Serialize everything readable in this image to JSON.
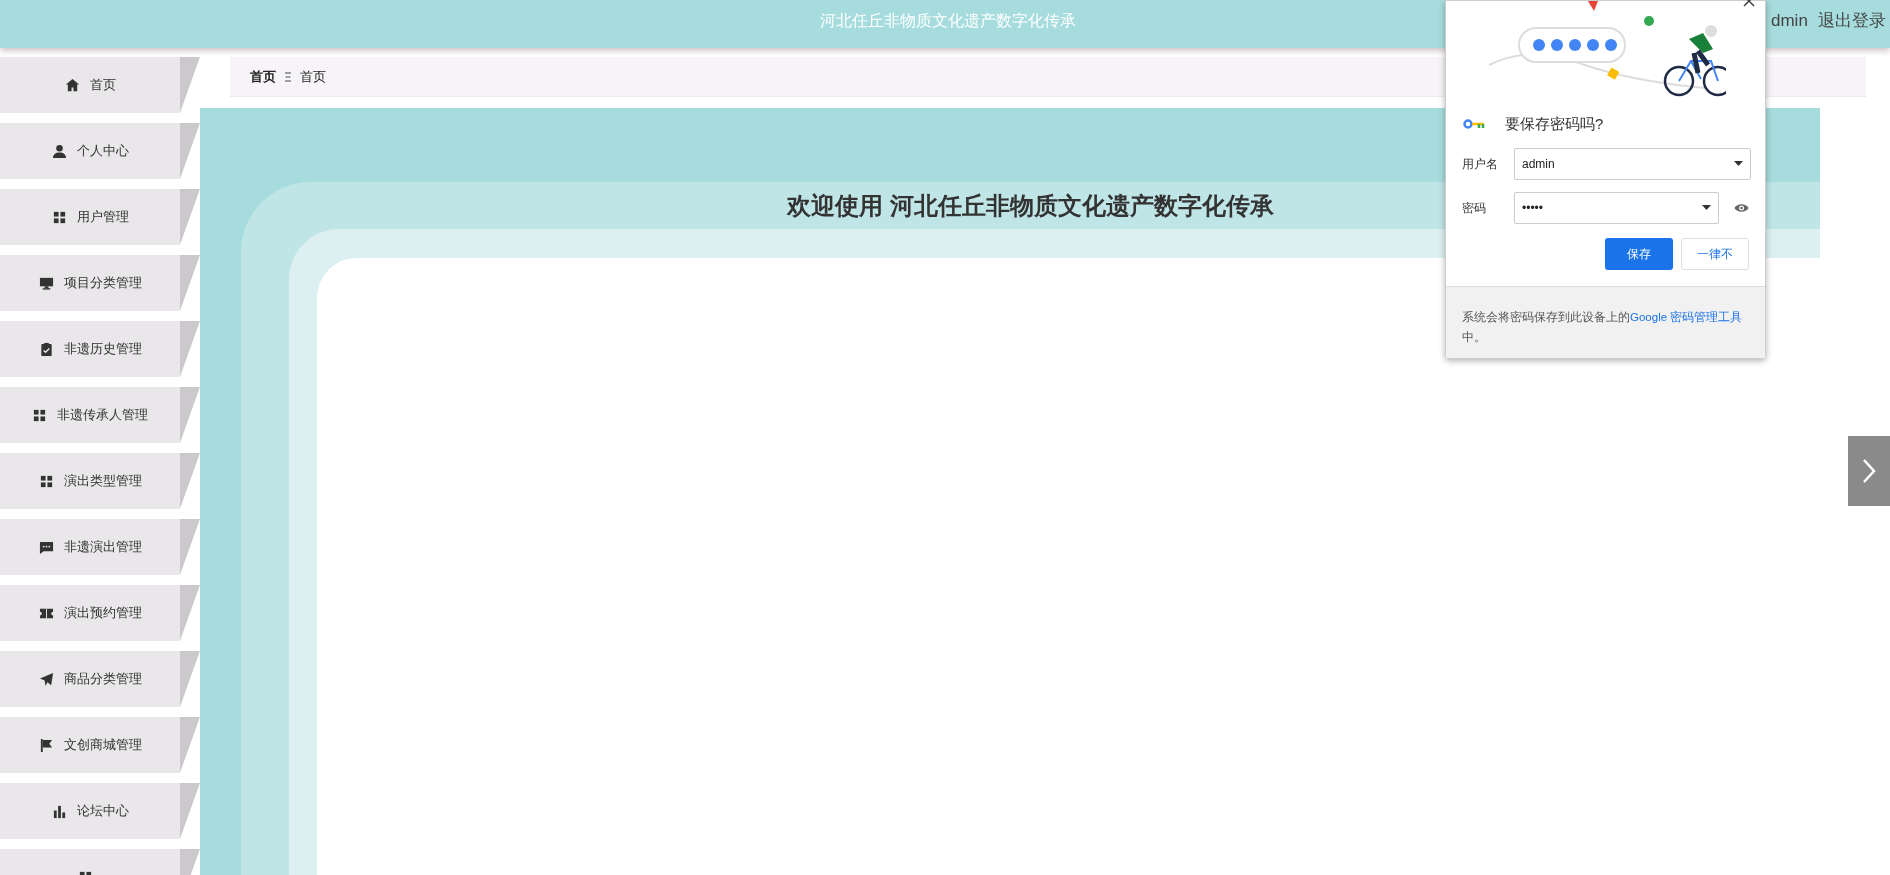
{
  "header": {
    "title": "河北任丘非物质文化遗产数字化传承",
    "user": "dmin",
    "logout": "退出登录"
  },
  "sidebar": {
    "items": [
      {
        "kind": "home",
        "label": "首页"
      },
      {
        "kind": "user",
        "label": "个人中心"
      },
      {
        "kind": "grid",
        "label": "用户管理"
      },
      {
        "kind": "monitor",
        "label": "项目分类管理"
      },
      {
        "kind": "clipboard",
        "label": "非遗历史管理"
      },
      {
        "kind": "grid",
        "label": "非遗传承人管理"
      },
      {
        "kind": "grid",
        "label": "演出类型管理"
      },
      {
        "kind": "chat",
        "label": "非遗演出管理"
      },
      {
        "kind": "ticket",
        "label": "演出预约管理"
      },
      {
        "kind": "send",
        "label": "商品分类管理"
      },
      {
        "kind": "flag",
        "label": "文创商城管理"
      },
      {
        "kind": "chart",
        "label": "论坛中心"
      },
      {
        "kind": "grid"
      }
    ]
  },
  "breadcrumb": [
    "首页",
    "首页"
  ],
  "welcome": "欢迎使用 河北任丘非物质文化遗产数字化传承",
  "password_dialog": {
    "title": "要保存密码吗?",
    "fields": [
      {
        "label": "用户名",
        "value": "admin",
        "kind": "text"
      },
      {
        "label": "密码",
        "value": "•••••",
        "kind": "password"
      }
    ],
    "buttons": [
      {
        "label": "保存",
        "kind": "primary"
      },
      {
        "label": "一律不",
        "kind": "secondary"
      }
    ],
    "footer": {
      "text": "系统会将密码保存到此设备上的",
      "link": "Google 密码管理工具",
      "suffix": "中。"
    }
  }
}
